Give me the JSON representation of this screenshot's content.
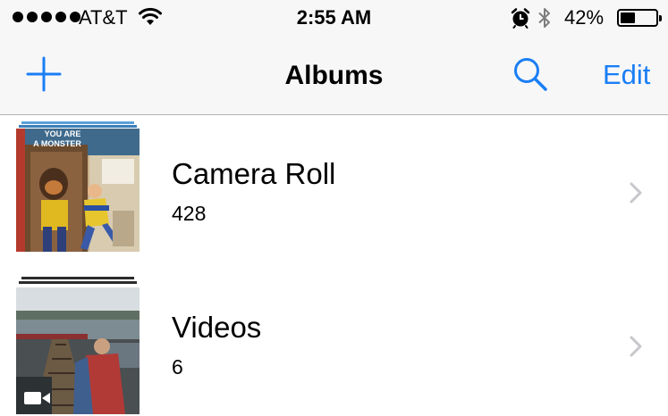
{
  "status_bar": {
    "carrier": "AT&T",
    "time": "2:55 AM",
    "battery_percent": "42%",
    "battery_level": 0.42,
    "signal_bars": 5,
    "icons": [
      "wifi-icon",
      "alarm-clock-icon",
      "bluetooth-icon",
      "battery-icon"
    ]
  },
  "nav": {
    "title": "Albums",
    "edit_label": "Edit",
    "add_icon": "plus-icon",
    "search_icon": "search-icon",
    "accent_color": "#1a7ef5"
  },
  "albums": [
    {
      "title": "Camera Roll",
      "count": "428",
      "cover_text": [
        "YOU ARE",
        "A MONSTER"
      ]
    },
    {
      "title": "Videos",
      "count": "6",
      "cover_icon": "video-camera-icon"
    }
  ],
  "chevron_icon": "chevron-right-icon"
}
